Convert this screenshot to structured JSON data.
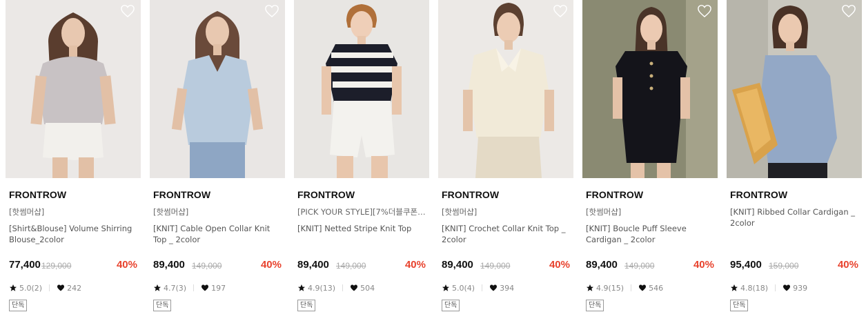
{
  "products": [
    {
      "brand": "FRONTROW",
      "tag": "[핫썸머샵]",
      "name": "[Shirt&Blouse] Volume Shirring Blouse_2color",
      "price": "77,400",
      "original_price": "129,000",
      "discount": "40%",
      "rating": "5.0(2)",
      "likes": "242",
      "badge": "단독",
      "bg": "#ebe8e6",
      "top_color": "#c8c2c4",
      "bottom_color": "#f2f0ec",
      "hair": "#5a3d2e"
    },
    {
      "brand": "FRONTROW",
      "tag": "[핫썸머샵]",
      "name": "[KNIT] Cable Open Collar Knit Top _ 2color",
      "price": "89,400",
      "original_price": "149,000",
      "discount": "40%",
      "rating": "4.7(3)",
      "likes": "197",
      "badge": "단독",
      "bg": "#e9e6e4",
      "top_color": "#b9cbdd",
      "bottom_color": "#8ea6c4",
      "hair": "#6a4a3a"
    },
    {
      "brand": "FRONTROW",
      "tag": "[PICK YOUR STYLE][7%더블쿠폰][…",
      "name": "[KNIT] Netted Stripe Knit Top",
      "price": "89,400",
      "original_price": "149,000",
      "discount": "40%",
      "rating": "4.9(13)",
      "likes": "504",
      "badge": "단독",
      "bg": "#e8e6e3",
      "top_color": "#1c1e2a",
      "bottom_color": "#f3f2ee",
      "hair": "#b0703a"
    },
    {
      "brand": "FRONTROW",
      "tag": "[핫썸머샵]",
      "name": "[KNIT] Crochet Collar Knit Top _ 2color",
      "price": "89,400",
      "original_price": "149,000",
      "discount": "40%",
      "rating": "5.0(4)",
      "likes": "394",
      "badge": "단독",
      "bg": "#ece9e6",
      "top_color": "#f1ead8",
      "bottom_color": "#e4dac6",
      "hair": "#5c4030"
    },
    {
      "brand": "FRONTROW",
      "tag": "[핫썸머샵]",
      "name": "[KNIT] Boucle Puff Sleeve Cardigan _ 2color",
      "price": "89,400",
      "original_price": "149,000",
      "discount": "40%",
      "rating": "4.9(15)",
      "likes": "546",
      "badge": "단독",
      "bg": "#8a8a72",
      "top_color": "#14141a",
      "bottom_color": "#1c1c22",
      "hair": "#4a3428"
    },
    {
      "brand": "FRONTROW",
      "tag": "",
      "name": "[KNIT] Ribbed Collar Cardigan _ 2color",
      "price": "95,400",
      "original_price": "159,000",
      "discount": "40%",
      "rating": "4.8(18)",
      "likes": "939",
      "badge": "단독",
      "bg": "#c9c7be",
      "top_color": "#93a8c6",
      "bottom_color": "#1f1f24",
      "hair": "#4a3226"
    }
  ]
}
